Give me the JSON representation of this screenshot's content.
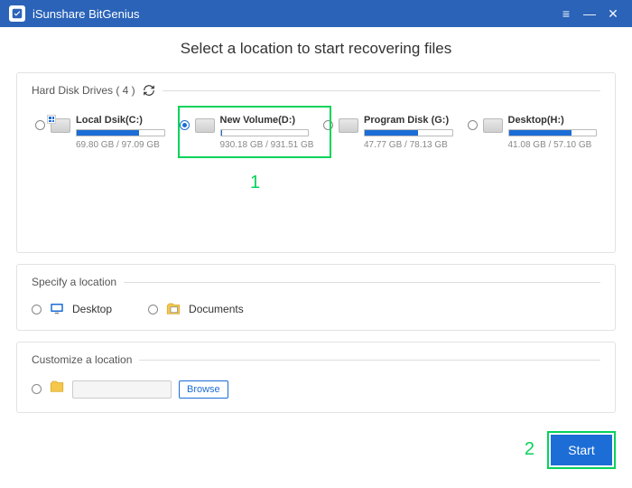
{
  "title": "iSunshare BitGenius",
  "page_title": "Select a location to start recovering files",
  "drives_section": {
    "label": "Hard Disk Drives ( 4 )",
    "items": [
      {
        "name": "Local Dsik(C:)",
        "used": "69.80 GB",
        "total": "97.09 GB",
        "fill_pct": 72,
        "selected": false,
        "icon": "c"
      },
      {
        "name": "New Volume(D:)",
        "used": "930.18 GB",
        "total": "931.51 GB",
        "fill_pct": 2,
        "selected": true,
        "icon": "plain"
      },
      {
        "name": "Program Disk (G:)",
        "used": "47.77 GB",
        "total": "78.13 GB",
        "fill_pct": 61,
        "selected": false,
        "icon": "plain"
      },
      {
        "name": "Desktop(H:)",
        "used": "41.08 GB",
        "total": "57.10 GB",
        "fill_pct": 72,
        "selected": false,
        "icon": "plain"
      }
    ]
  },
  "specify_section": {
    "label": "Specify a location",
    "desktop": "Desktop",
    "documents": "Documents"
  },
  "customize_section": {
    "label": "Customize a location",
    "browse": "Browse"
  },
  "start_label": "Start",
  "annotations": {
    "one": "1",
    "two": "2"
  }
}
